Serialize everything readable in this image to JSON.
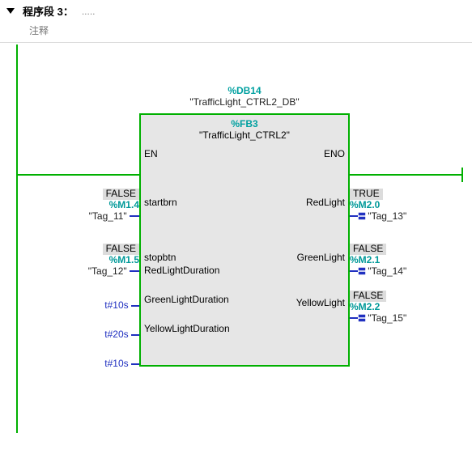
{
  "segment": {
    "title": "程序段 3：",
    "dots": ".....",
    "comment_label": "注释"
  },
  "db": {
    "symbol": "%DB14",
    "name": "\"TrafficLight_CTRL2_DB\""
  },
  "fb": {
    "symbol": "%FB3",
    "name": "\"TrafficLight_CTRL2\""
  },
  "pins": {
    "en": "EN",
    "eno": "ENO",
    "in1": "startbrn",
    "in2": "stopbtn",
    "in3": "RedLightDuration",
    "in4": "GreenLightDuration",
    "in5": "YellowLightDuration",
    "out1": "RedLight",
    "out2": "GreenLight",
    "out3": "YellowLight"
  },
  "inputs": {
    "i1": {
      "state": "FALSE",
      "addr": "%M1.4",
      "tag": "\"Tag_11\""
    },
    "i2": {
      "state": "FALSE",
      "addr": "%M1.5",
      "tag": "\"Tag_12\""
    },
    "i3": {
      "literal": "t#10s"
    },
    "i4": {
      "literal": "t#20s"
    },
    "i5": {
      "literal": "t#10s"
    }
  },
  "outputs": {
    "o1": {
      "state": "TRUE",
      "addr": "%M2.0",
      "tag": "\"Tag_13\""
    },
    "o2": {
      "state": "FALSE",
      "addr": "%M2.1",
      "tag": "\"Tag_14\""
    },
    "o3": {
      "state": "FALSE",
      "addr": "%M2.2",
      "tag": "\"Tag_15\""
    }
  }
}
